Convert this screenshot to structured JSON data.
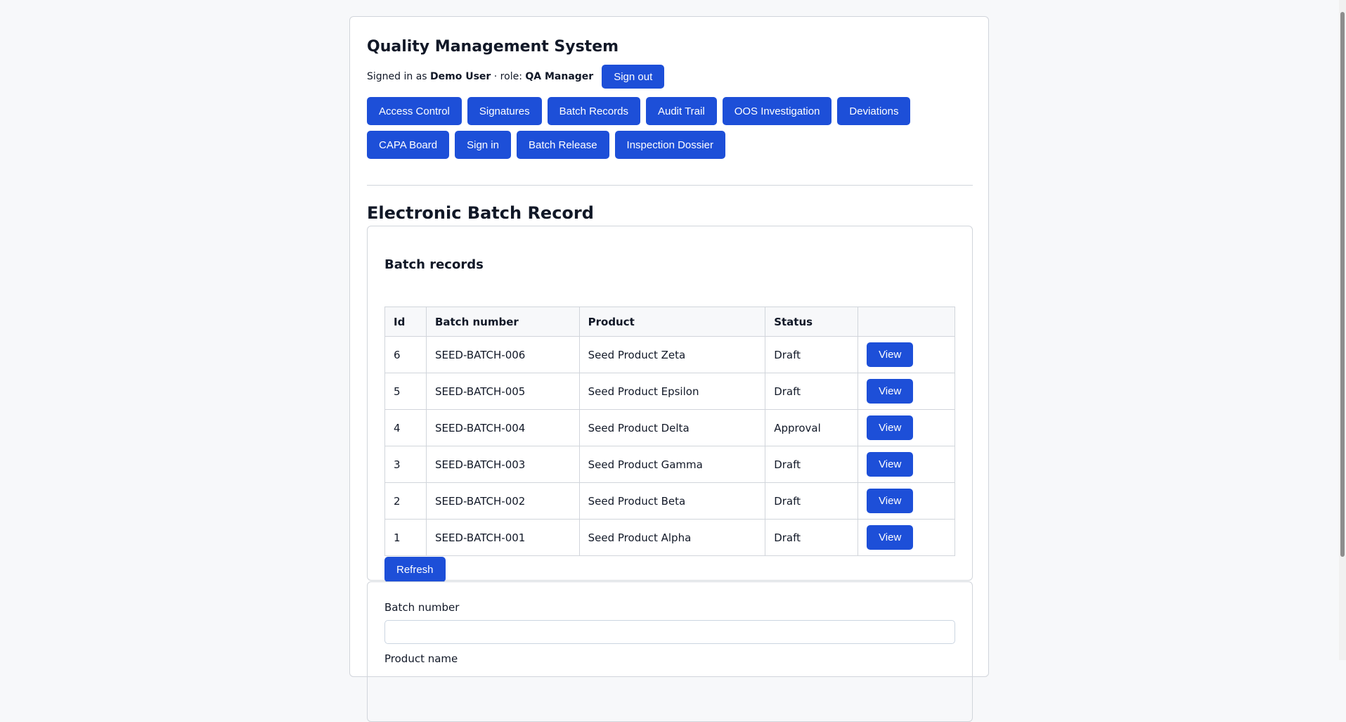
{
  "app": {
    "title": "Quality Management System"
  },
  "user": {
    "signed_in_prefix": "Signed in as",
    "name": "Demo User",
    "role_separator": "· role:",
    "role": "QA Manager",
    "sign_out_label": "Sign out"
  },
  "nav": {
    "items": [
      {
        "label": "Access Control"
      },
      {
        "label": "Signatures"
      },
      {
        "label": "Batch Records"
      },
      {
        "label": "Audit Trail"
      },
      {
        "label": "OOS Investigation"
      },
      {
        "label": "Deviations"
      },
      {
        "label": "CAPA Board"
      },
      {
        "label": "Sign in"
      },
      {
        "label": "Batch Release"
      },
      {
        "label": "Inspection Dossier"
      }
    ]
  },
  "page": {
    "title": "Electronic Batch Record"
  },
  "records": {
    "heading": "Batch records",
    "columns": {
      "id": "Id",
      "batch_number": "Batch number",
      "product": "Product",
      "status": "Status",
      "action": ""
    },
    "rows": [
      {
        "id": "6",
        "batch_number": "SEED-BATCH-006",
        "product": "Seed Product Zeta",
        "status": "Draft",
        "action": "View"
      },
      {
        "id": "5",
        "batch_number": "SEED-BATCH-005",
        "product": "Seed Product Epsilon",
        "status": "Draft",
        "action": "View"
      },
      {
        "id": "4",
        "batch_number": "SEED-BATCH-004",
        "product": "Seed Product Delta",
        "status": "Approval",
        "action": "View"
      },
      {
        "id": "3",
        "batch_number": "SEED-BATCH-003",
        "product": "Seed Product Gamma",
        "status": "Draft",
        "action": "View"
      },
      {
        "id": "2",
        "batch_number": "SEED-BATCH-002",
        "product": "Seed Product Beta",
        "status": "Draft",
        "action": "View"
      },
      {
        "id": "1",
        "batch_number": "SEED-BATCH-001",
        "product": "Seed Product Alpha",
        "status": "Draft",
        "action": "View"
      }
    ],
    "refresh_label": "Refresh"
  },
  "form": {
    "batch_number_label": "Batch number",
    "batch_number_value": "",
    "product_name_label": "Product name"
  },
  "colors": {
    "primary": "#1d4fd8",
    "border": "#d1d5db",
    "background": "#f7f8fa"
  }
}
